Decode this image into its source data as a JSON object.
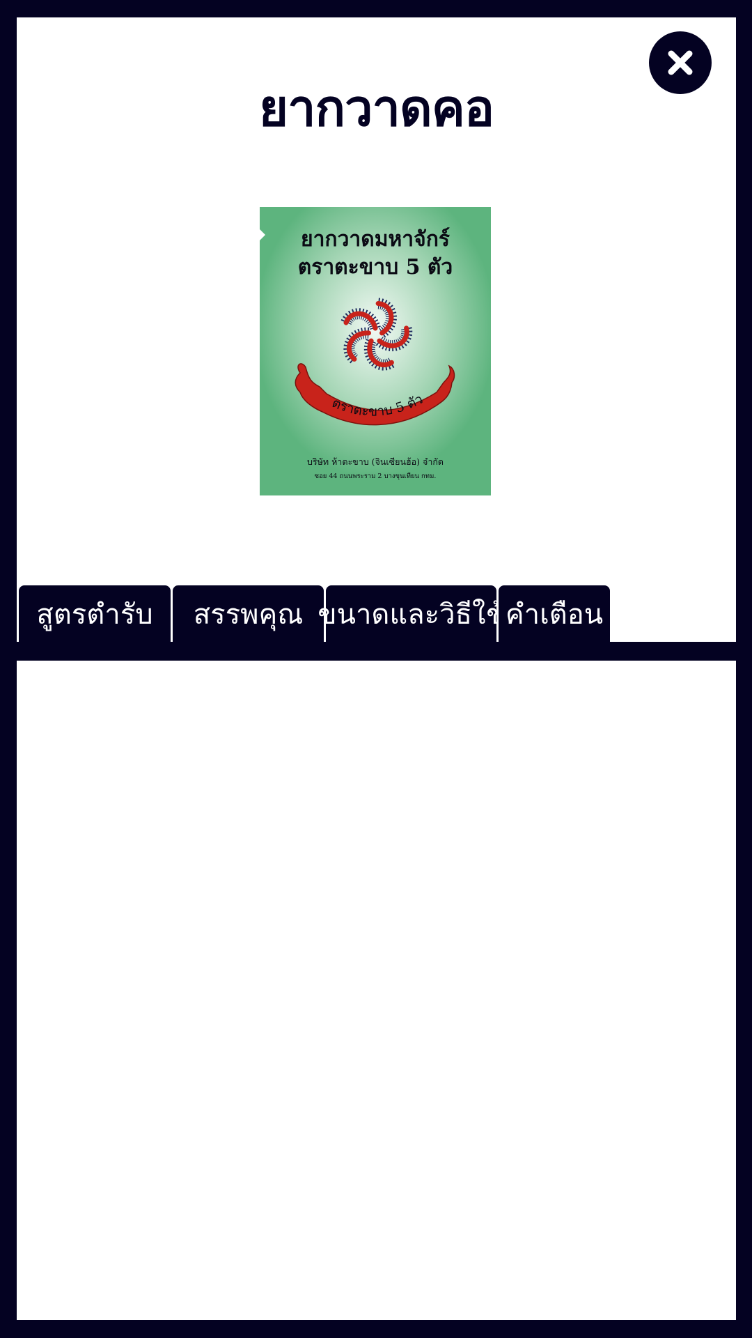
{
  "header": {
    "title": "ยากวาดคอ",
    "close_icon": "close-icon"
  },
  "product": {
    "name_line1": "ยากวาดมหาจักร์",
    "name_line2": "ตราตะขาบ 5 ตัว",
    "ribbon_text": "ตราตะขาบ 5 ตัว",
    "company": "บริษัท ห้าตะขาบ (จินเซียนฮ้อ) จำกัด",
    "address": "ซอย 44 ถนนพระราม 2 บางขุนเทียน กทม.",
    "colors": {
      "background": "#5db47e",
      "glow": "#f2f9f4",
      "centipede": "#c8231b",
      "legs": "#1d2a5c"
    }
  },
  "tabs": [
    {
      "label": "สูตรตำรับ"
    },
    {
      "label": "สรรพคุณ"
    },
    {
      "label": "ขนาดและวิธีใช้"
    },
    {
      "label": "คำเตือน"
    }
  ],
  "colors": {
    "frame": "#040222",
    "panel": "#ffffff"
  }
}
